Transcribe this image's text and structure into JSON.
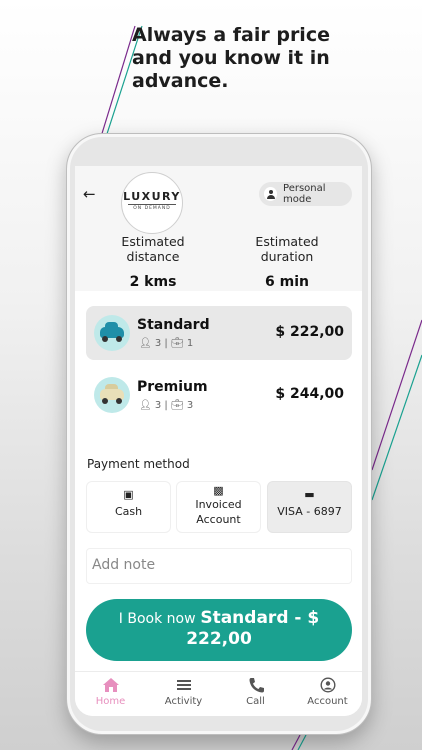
{
  "headline": "Always a  fair price\n and  you know it in\nadvance.",
  "colors": {
    "accent": "#1aa190",
    "active_tab": "#e78fbe",
    "purple_stripe": "#7a2a8c",
    "teal_stripe": "#1aa190"
  },
  "header": {
    "back_icon": "arrow-left-icon",
    "logo": {
      "main": "LUXURY",
      "sub": "ON DEMAND"
    },
    "mode_label": "Personal mode"
  },
  "stats": {
    "distance": {
      "label": "Estimated distance",
      "value": "2 kms"
    },
    "duration": {
      "label": "Estimated duration",
      "value": "6 min"
    }
  },
  "rides": [
    {
      "name": "Standard",
      "passengers": "3",
      "bags": "1",
      "price": "$ 222,00",
      "selected": true,
      "car_color": "#1f8fa8"
    },
    {
      "name": "Premium",
      "passengers": "3",
      "bags": "3",
      "price": "$ 244,00",
      "selected": false,
      "car_color": "#e9dfb8"
    }
  ],
  "payment": {
    "title": "Payment method",
    "options": [
      {
        "label": "Cash",
        "icon": "banknote-icon",
        "active": false
      },
      {
        "label": "Invoiced Account",
        "icon": "clipboard-icon",
        "active": false
      },
      {
        "label": "VISA - 6897",
        "icon": "credit-card-icon",
        "active": true
      }
    ]
  },
  "note_placeholder": "Add note",
  "book": {
    "prefix": "I Book now",
    "suffix": "Standard - $",
    "price": "222,00"
  },
  "tabs": [
    {
      "label": "Home",
      "icon": "home-icon",
      "active": true
    },
    {
      "label": "Activity",
      "icon": "list-icon",
      "active": false
    },
    {
      "label": "Call",
      "icon": "phone-icon",
      "active": false
    },
    {
      "label": "Account",
      "icon": "user-circle-icon",
      "active": false
    }
  ]
}
